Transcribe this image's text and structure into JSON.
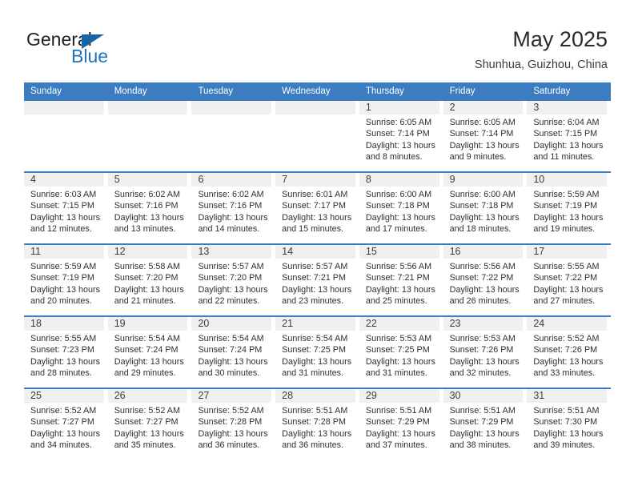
{
  "brand": {
    "name_part1": "General",
    "name_part2": "Blue",
    "accent_color": "#1a74bd",
    "triangle_icon": "triangle-logo-icon"
  },
  "header": {
    "title": "May 2025",
    "subtitle": "Shunhua, Guizhou, China"
  },
  "theme": {
    "header_blue": "#3b7dc0",
    "row_divider_blue": "#3b7dc0",
    "daynum_band_gray": "#f0f0f0",
    "text_color": "#2f2f2f"
  },
  "calendar": {
    "weekday_headers": [
      "Sunday",
      "Monday",
      "Tuesday",
      "Wednesday",
      "Thursday",
      "Friday",
      "Saturday"
    ],
    "weeks": [
      [
        {
          "day": "",
          "lines": []
        },
        {
          "day": "",
          "lines": []
        },
        {
          "day": "",
          "lines": []
        },
        {
          "day": "",
          "lines": []
        },
        {
          "day": "1",
          "lines": [
            "Sunrise: 6:05 AM",
            "Sunset: 7:14 PM",
            "Daylight: 13 hours",
            "and 8 minutes."
          ]
        },
        {
          "day": "2",
          "lines": [
            "Sunrise: 6:05 AM",
            "Sunset: 7:14 PM",
            "Daylight: 13 hours",
            "and 9 minutes."
          ]
        },
        {
          "day": "3",
          "lines": [
            "Sunrise: 6:04 AM",
            "Sunset: 7:15 PM",
            "Daylight: 13 hours",
            "and 11 minutes."
          ]
        }
      ],
      [
        {
          "day": "4",
          "lines": [
            "Sunrise: 6:03 AM",
            "Sunset: 7:15 PM",
            "Daylight: 13 hours",
            "and 12 minutes."
          ]
        },
        {
          "day": "5",
          "lines": [
            "Sunrise: 6:02 AM",
            "Sunset: 7:16 PM",
            "Daylight: 13 hours",
            "and 13 minutes."
          ]
        },
        {
          "day": "6",
          "lines": [
            "Sunrise: 6:02 AM",
            "Sunset: 7:16 PM",
            "Daylight: 13 hours",
            "and 14 minutes."
          ]
        },
        {
          "day": "7",
          "lines": [
            "Sunrise: 6:01 AM",
            "Sunset: 7:17 PM",
            "Daylight: 13 hours",
            "and 15 minutes."
          ]
        },
        {
          "day": "8",
          "lines": [
            "Sunrise: 6:00 AM",
            "Sunset: 7:18 PM",
            "Daylight: 13 hours",
            "and 17 minutes."
          ]
        },
        {
          "day": "9",
          "lines": [
            "Sunrise: 6:00 AM",
            "Sunset: 7:18 PM",
            "Daylight: 13 hours",
            "and 18 minutes."
          ]
        },
        {
          "day": "10",
          "lines": [
            "Sunrise: 5:59 AM",
            "Sunset: 7:19 PM",
            "Daylight: 13 hours",
            "and 19 minutes."
          ]
        }
      ],
      [
        {
          "day": "11",
          "lines": [
            "Sunrise: 5:59 AM",
            "Sunset: 7:19 PM",
            "Daylight: 13 hours",
            "and 20 minutes."
          ]
        },
        {
          "day": "12",
          "lines": [
            "Sunrise: 5:58 AM",
            "Sunset: 7:20 PM",
            "Daylight: 13 hours",
            "and 21 minutes."
          ]
        },
        {
          "day": "13",
          "lines": [
            "Sunrise: 5:57 AM",
            "Sunset: 7:20 PM",
            "Daylight: 13 hours",
            "and 22 minutes."
          ]
        },
        {
          "day": "14",
          "lines": [
            "Sunrise: 5:57 AM",
            "Sunset: 7:21 PM",
            "Daylight: 13 hours",
            "and 23 minutes."
          ]
        },
        {
          "day": "15",
          "lines": [
            "Sunrise: 5:56 AM",
            "Sunset: 7:21 PM",
            "Daylight: 13 hours",
            "and 25 minutes."
          ]
        },
        {
          "day": "16",
          "lines": [
            "Sunrise: 5:56 AM",
            "Sunset: 7:22 PM",
            "Daylight: 13 hours",
            "and 26 minutes."
          ]
        },
        {
          "day": "17",
          "lines": [
            "Sunrise: 5:55 AM",
            "Sunset: 7:22 PM",
            "Daylight: 13 hours",
            "and 27 minutes."
          ]
        }
      ],
      [
        {
          "day": "18",
          "lines": [
            "Sunrise: 5:55 AM",
            "Sunset: 7:23 PM",
            "Daylight: 13 hours",
            "and 28 minutes."
          ]
        },
        {
          "day": "19",
          "lines": [
            "Sunrise: 5:54 AM",
            "Sunset: 7:24 PM",
            "Daylight: 13 hours",
            "and 29 minutes."
          ]
        },
        {
          "day": "20",
          "lines": [
            "Sunrise: 5:54 AM",
            "Sunset: 7:24 PM",
            "Daylight: 13 hours",
            "and 30 minutes."
          ]
        },
        {
          "day": "21",
          "lines": [
            "Sunrise: 5:54 AM",
            "Sunset: 7:25 PM",
            "Daylight: 13 hours",
            "and 31 minutes."
          ]
        },
        {
          "day": "22",
          "lines": [
            "Sunrise: 5:53 AM",
            "Sunset: 7:25 PM",
            "Daylight: 13 hours",
            "and 31 minutes."
          ]
        },
        {
          "day": "23",
          "lines": [
            "Sunrise: 5:53 AM",
            "Sunset: 7:26 PM",
            "Daylight: 13 hours",
            "and 32 minutes."
          ]
        },
        {
          "day": "24",
          "lines": [
            "Sunrise: 5:52 AM",
            "Sunset: 7:26 PM",
            "Daylight: 13 hours",
            "and 33 minutes."
          ]
        }
      ],
      [
        {
          "day": "25",
          "lines": [
            "Sunrise: 5:52 AM",
            "Sunset: 7:27 PM",
            "Daylight: 13 hours",
            "and 34 minutes."
          ]
        },
        {
          "day": "26",
          "lines": [
            "Sunrise: 5:52 AM",
            "Sunset: 7:27 PM",
            "Daylight: 13 hours",
            "and 35 minutes."
          ]
        },
        {
          "day": "27",
          "lines": [
            "Sunrise: 5:52 AM",
            "Sunset: 7:28 PM",
            "Daylight: 13 hours",
            "and 36 minutes."
          ]
        },
        {
          "day": "28",
          "lines": [
            "Sunrise: 5:51 AM",
            "Sunset: 7:28 PM",
            "Daylight: 13 hours",
            "and 36 minutes."
          ]
        },
        {
          "day": "29",
          "lines": [
            "Sunrise: 5:51 AM",
            "Sunset: 7:29 PM",
            "Daylight: 13 hours",
            "and 37 minutes."
          ]
        },
        {
          "day": "30",
          "lines": [
            "Sunrise: 5:51 AM",
            "Sunset: 7:29 PM",
            "Daylight: 13 hours",
            "and 38 minutes."
          ]
        },
        {
          "day": "31",
          "lines": [
            "Sunrise: 5:51 AM",
            "Sunset: 7:30 PM",
            "Daylight: 13 hours",
            "and 39 minutes."
          ]
        }
      ]
    ]
  }
}
